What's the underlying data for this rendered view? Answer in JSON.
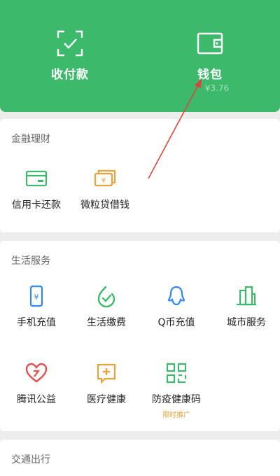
{
  "top": {
    "collect_pay": {
      "label": "收付款",
      "icon": "scan-check-icon"
    },
    "wallet": {
      "label": "钱包",
      "balance": "¥3.76",
      "icon": "wallet-icon"
    }
  },
  "finance": {
    "title": "金融理财",
    "items": [
      {
        "label": "信用卡还款",
        "icon": "credit-card-icon"
      },
      {
        "label": "微粒贷借钱",
        "icon": "loan-money-icon"
      }
    ]
  },
  "life": {
    "title": "生活服务",
    "items": [
      {
        "label": "手机充值",
        "icon": "phone-recharge-icon"
      },
      {
        "label": "生活缴费",
        "icon": "utility-payment-icon"
      },
      {
        "label": "Q币充值",
        "icon": "qq-coin-icon"
      },
      {
        "label": "城市服务",
        "icon": "city-service-icon"
      },
      {
        "label": "腾讯公益",
        "icon": "charity-heart-icon"
      },
      {
        "label": "医疗健康",
        "icon": "medical-health-icon"
      },
      {
        "label": "防疫健康码",
        "icon": "health-qrcode-icon",
        "badge": "限时推广"
      }
    ]
  },
  "transport": {
    "title": "交通出行"
  },
  "colors": {
    "brand_green": "#3cb96b",
    "icon_blue": "#2f86f6",
    "icon_orange": "#e8a33c",
    "icon_red": "#e5504f",
    "annotation_red": "#d9473a"
  }
}
